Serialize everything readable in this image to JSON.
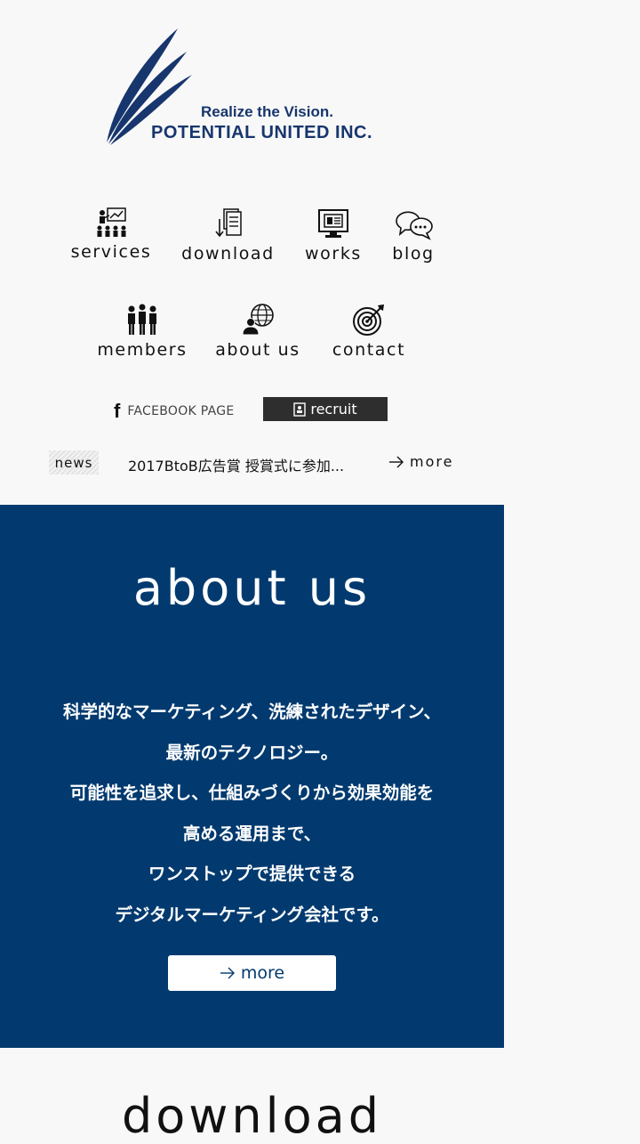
{
  "logo": {
    "tagline": "Realize the Vision.",
    "company": "POTENTIAL UNITED INC.",
    "brand_color": "#17366d"
  },
  "nav": {
    "items": [
      {
        "label": "services",
        "icon": "presentation-icon"
      },
      {
        "label": "download",
        "icon": "document-download-icon"
      },
      {
        "label": "works",
        "icon": "monitor-icon"
      },
      {
        "label": "blog",
        "icon": "speech-bubbles-icon"
      },
      {
        "label": "members",
        "icon": "people-group-icon"
      },
      {
        "label": "about us",
        "icon": "globe-person-icon"
      },
      {
        "label": "contact",
        "icon": "target-icon"
      }
    ]
  },
  "links": {
    "facebook_f": "f",
    "facebook_label": "FACEBOOK PAGE",
    "recruit_label": "recruit"
  },
  "news": {
    "tag": "news",
    "headline": "2017BtoB広告賞 授賞式に参加...",
    "more_label": "more"
  },
  "about": {
    "title": "about us",
    "lines": [
      "科学的なマーケティング、洗練されたデザイン、",
      "最新のテクノロジー。",
      "可能性を追求し、仕組みづくりから効果効能を",
      "高める運用まで、",
      "ワンストップで提供できる",
      "デジタルマーケティング会社です。"
    ],
    "more_label": "more",
    "panel_color": "#023a6f"
  },
  "download": {
    "title": "download"
  }
}
